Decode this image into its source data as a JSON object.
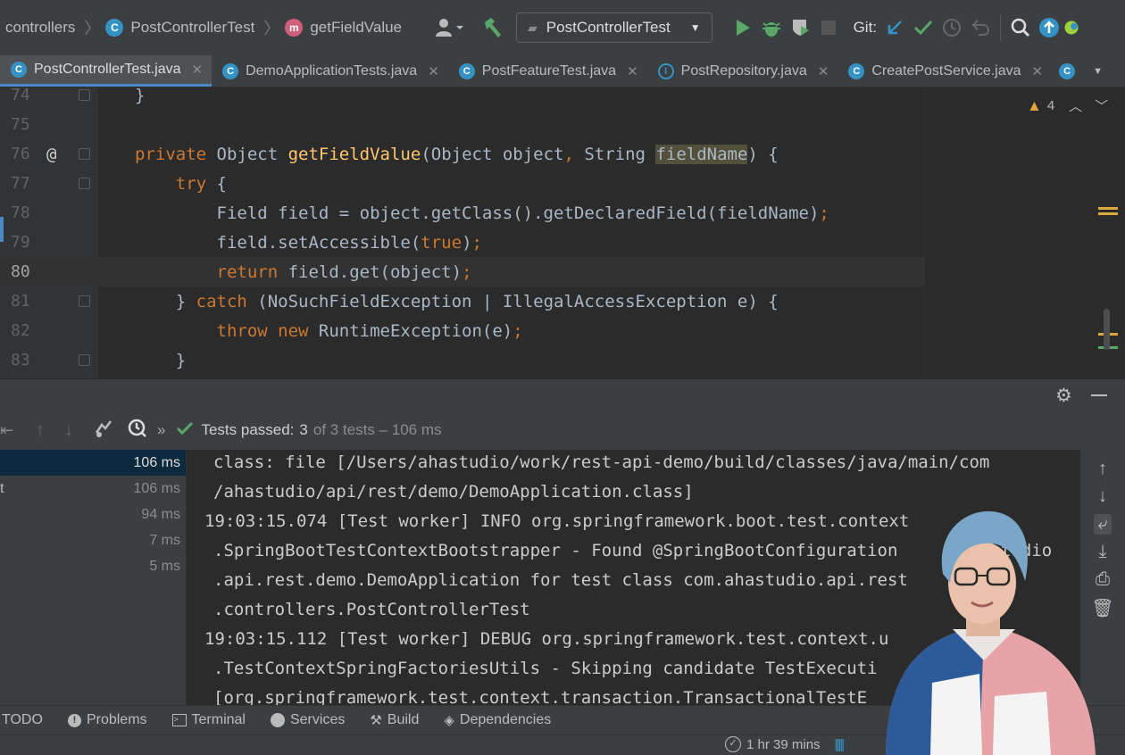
{
  "toolbar": {
    "breadcrumbs": [
      "controllers",
      "PostControllerTest",
      "getFieldValue"
    ],
    "run_config": "PostControllerTest",
    "git_label": "Git:"
  },
  "tabs": [
    {
      "label": "PostControllerTest.java",
      "active": true
    },
    {
      "label": "DemoApplicationTests.java",
      "active": false
    },
    {
      "label": "PostFeatureTest.java",
      "active": false
    },
    {
      "label": "PostRepository.java",
      "active": false
    },
    {
      "label": "CreatePostService.java",
      "active": false
    }
  ],
  "editor": {
    "warning_count": "4",
    "line_numbers": [
      "74",
      "75",
      "76",
      "77",
      "78",
      "79",
      "80",
      "81",
      "82",
      "83"
    ],
    "annotation": "@"
  },
  "run": {
    "status_label": "Tests passed:",
    "status_count": "3",
    "status_rest": "of 3 tests – 106 ms",
    "tree": [
      {
        "name": "",
        "time": "106 ms"
      },
      {
        "name": "t",
        "time": "106 ms"
      },
      {
        "name": "",
        "time": "94 ms"
      },
      {
        "name": "",
        "time": "7 ms"
      },
      {
        "name": "",
        "time": "5 ms"
      }
    ],
    "console": [
      "class: file [/Users/ahastudio/work/rest-api-demo/build/classes/java/main/com",
      "/ahastudio/api/rest/demo/DemoApplication.class]",
      "19:03:15.074 [Test worker] INFO org.springframework.boot.test.context",
      ".SpringBootTestContextBootstrapper - Found @SpringBootConfiguration",
      ".api.rest.demo.DemoApplication for test class com.ahastudio.api.rest",
      ".controllers.PostControllerTest",
      "19:03:15.112 [Test worker] DEBUG org.springframework.test.context.u",
      ".TestContextSpringFactoriesUtils - Skipping candidate TestExecuti",
      "[org.springframework.test.context.transaction.TransactionalTestE"
    ],
    "console_fragment": "tudio"
  },
  "toolwindows": [
    "TODO",
    "Problems",
    "Terminal",
    "Services",
    "Build",
    "Dependencies"
  ],
  "statusbar": {
    "time": "1 hr 39 mins"
  },
  "colors": {
    "accent": "#4a88c7",
    "keyword": "#cc7832",
    "method": "#ffc66d",
    "pass": "#59a869"
  }
}
